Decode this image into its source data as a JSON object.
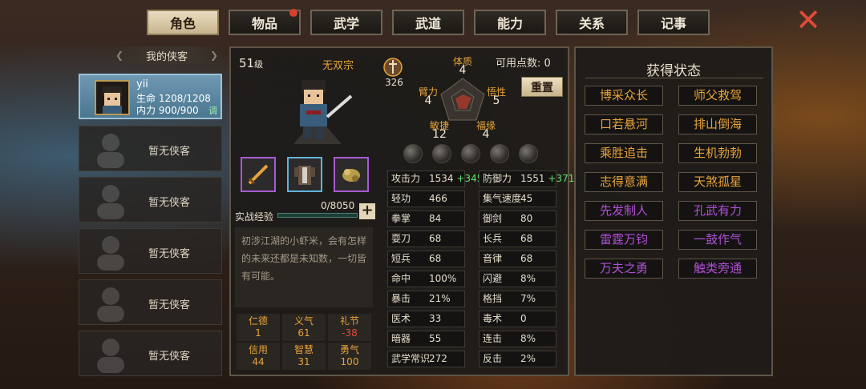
{
  "tabs": [
    {
      "label": "角色",
      "active": true
    },
    {
      "label": "物品",
      "notify": true
    },
    {
      "label": "武学"
    },
    {
      "label": "武道"
    },
    {
      "label": "能力"
    },
    {
      "label": "关系"
    },
    {
      "label": "记事"
    }
  ],
  "list": {
    "title": "我的侠客",
    "hero": {
      "name": "yii",
      "hp": "生命 1208/1208",
      "mp": "内力 900/900",
      "tune": "调"
    },
    "empty_label": "暂无侠客"
  },
  "profile": {
    "level": "51",
    "level_unit": "级",
    "title": "无双宗",
    "badge_value": "326",
    "available_points": "可用点数: 0",
    "reset_label": "重置",
    "attrs": [
      {
        "label": "体质",
        "value": "4"
      },
      {
        "label": "臂力",
        "value": "4"
      },
      {
        "label": "悟性",
        "value": "5"
      },
      {
        "label": "敏捷",
        "value": "12"
      },
      {
        "label": "福缘",
        "value": "4"
      }
    ],
    "exp_label": "实战经验",
    "exp_value": "0/8050",
    "exp_plus": "+",
    "description": "初涉江湖的小虾米，会有怎样的未来还都是未知数，一切皆有可能。",
    "virtues": [
      {
        "label": "仁德",
        "value": "1"
      },
      {
        "label": "义气",
        "value": "61"
      },
      {
        "label": "礼节",
        "value": "-38"
      },
      {
        "label": "信用",
        "value": "44"
      },
      {
        "label": "智慧",
        "value": "31"
      },
      {
        "label": "勇气",
        "value": "100"
      }
    ]
  },
  "stats": [
    {
      "label": "攻击力",
      "value": "1534",
      "bonus": "+345"
    },
    {
      "label": "防御力",
      "value": "1551",
      "bonus": "+371"
    },
    {
      "label": "轻功",
      "value": "466"
    },
    {
      "label": "集气速度",
      "value": "45"
    },
    {
      "label": "拳掌",
      "value": "84"
    },
    {
      "label": "御剑",
      "value": "80"
    },
    {
      "label": "耍刀",
      "value": "68"
    },
    {
      "label": "长兵",
      "value": "68"
    },
    {
      "label": "短兵",
      "value": "68"
    },
    {
      "label": "音律",
      "value": "68"
    },
    {
      "label": "命中",
      "value": "100%"
    },
    {
      "label": "闪避",
      "value": "8%"
    },
    {
      "label": "暴击",
      "value": "21%"
    },
    {
      "label": "格挡",
      "value": "7%"
    },
    {
      "label": "医术",
      "value": "33"
    },
    {
      "label": "毒术",
      "value": "0"
    },
    {
      "label": "暗器",
      "value": "55"
    },
    {
      "label": "连击",
      "value": "8%"
    },
    {
      "label": "武学常识",
      "value": "272"
    },
    {
      "label": "反击",
      "value": "2%"
    }
  ],
  "status_panel": {
    "title": "获得状态",
    "items": [
      {
        "label": "博采众长",
        "color": "gold"
      },
      {
        "label": "师父救驾",
        "color": "gold"
      },
      {
        "label": "口若悬河",
        "color": "gold"
      },
      {
        "label": "排山倒海",
        "color": "gold"
      },
      {
        "label": "乘胜追击",
        "color": "gold"
      },
      {
        "label": "生机勃勃",
        "color": "gold"
      },
      {
        "label": "志得意满",
        "color": "gold"
      },
      {
        "label": "天煞孤星",
        "color": "gold"
      },
      {
        "label": "先发制人",
        "color": "purple"
      },
      {
        "label": "孔武有力",
        "color": "purple"
      },
      {
        "label": "雷霆万钧",
        "color": "purple"
      },
      {
        "label": "一鼓作气",
        "color": "purple"
      },
      {
        "label": "万夫之勇",
        "color": "purple"
      },
      {
        "label": "触类旁通",
        "color": "purple"
      }
    ]
  }
}
